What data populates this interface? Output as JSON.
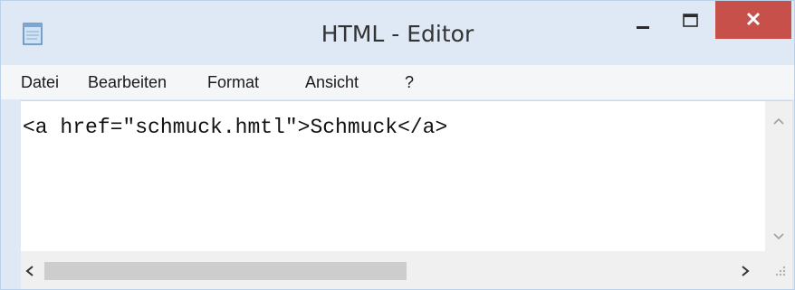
{
  "window": {
    "title": "HTML - Editor",
    "icons": {
      "app": "notepad-icon",
      "minimize": "minimize-icon",
      "maximize": "maximize-icon",
      "close": "close-icon"
    },
    "colors": {
      "frame": "#dfe9f5",
      "close_button": "#c7504b",
      "menubar": "#f5f6f7",
      "editor_bg": "#ffffff"
    }
  },
  "menu": {
    "items": [
      {
        "label": "Datei"
      },
      {
        "label": "Bearbeiten"
      },
      {
        "label": "Format"
      },
      {
        "label": "Ansicht"
      },
      {
        "label": "?"
      }
    ]
  },
  "editor": {
    "content": "<a href=\"schmuck.hmtl\">Schmuck</a>"
  },
  "scrollbars": {
    "icons": {
      "up": "chevron-up-icon",
      "down": "chevron-down-icon",
      "left": "chevron-left-icon",
      "right": "chevron-right-icon",
      "grip": "resize-grip-icon"
    }
  }
}
